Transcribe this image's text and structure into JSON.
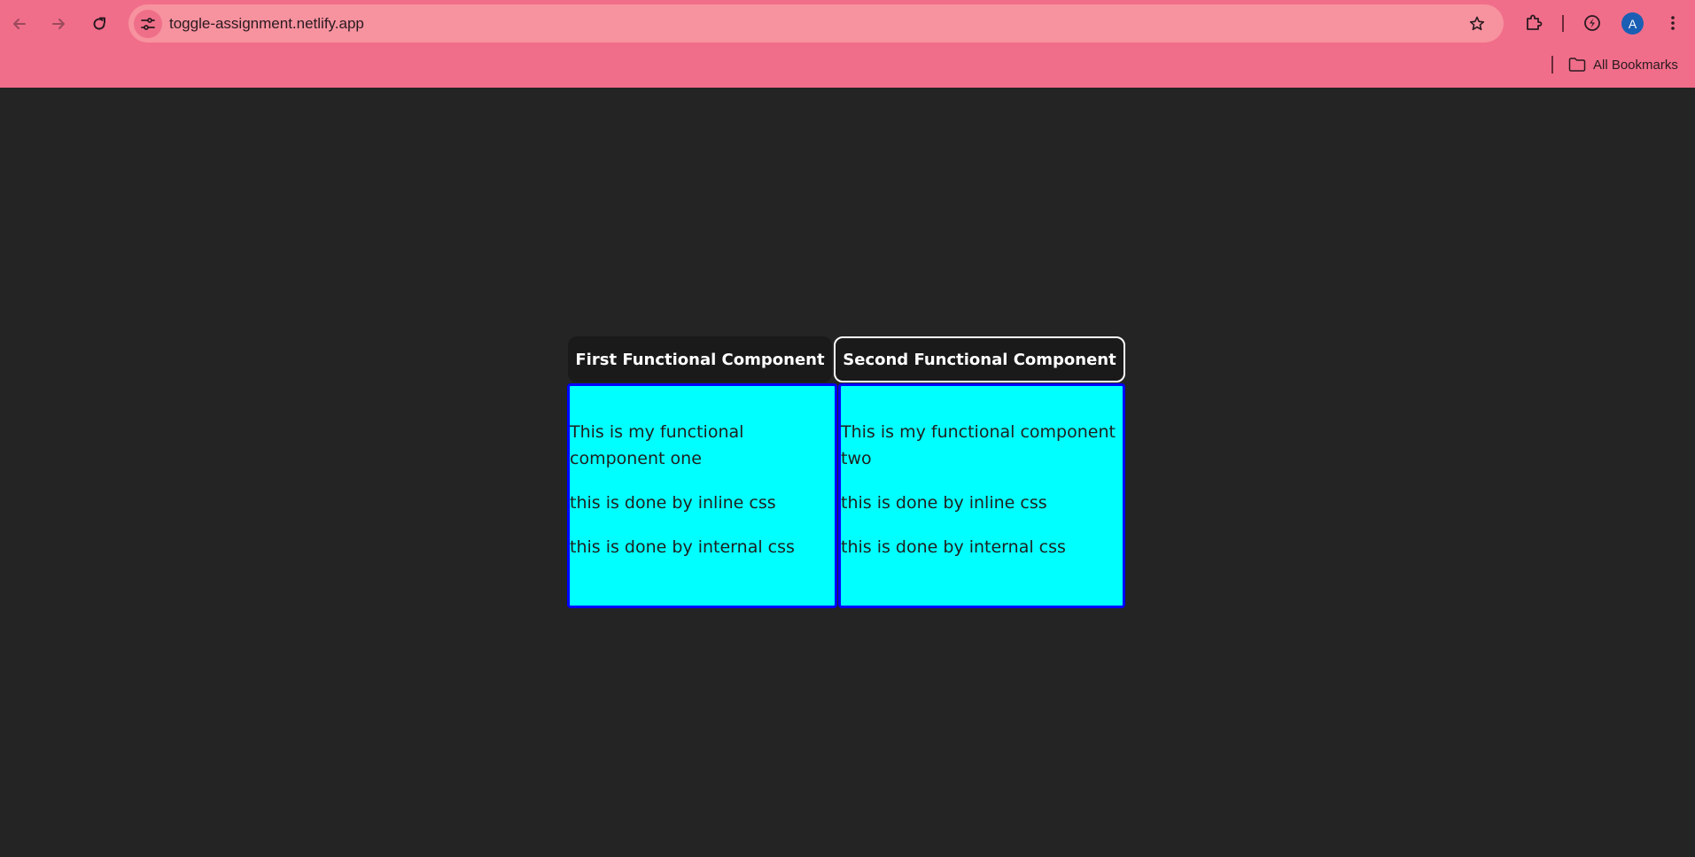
{
  "browser": {
    "url": "toggle-assignment.netlify.app",
    "profile_initial": "A",
    "bookmarks_label": "All Bookmarks",
    "colors": {
      "toolbar": "#f06e8a",
      "omnibox": "#f7929f",
      "avatar": "#1a5fb4"
    }
  },
  "page": {
    "background": "#242424",
    "tabs": [
      {
        "label": "First Functional Component"
      },
      {
        "label": "Second Functional Component"
      }
    ],
    "panels": [
      {
        "line1": "This is my functional component one",
        "line2": "this is done by inline css",
        "line3": "this is done by internal css"
      },
      {
        "line1": "This is my functional component two",
        "line2": "this is done by inline css",
        "line3": "this is done by internal css"
      }
    ],
    "colors": {
      "panel_fill": "#00ffff",
      "panel_border": "#0000ff",
      "tab_bg": "#1a1a1a"
    }
  }
}
